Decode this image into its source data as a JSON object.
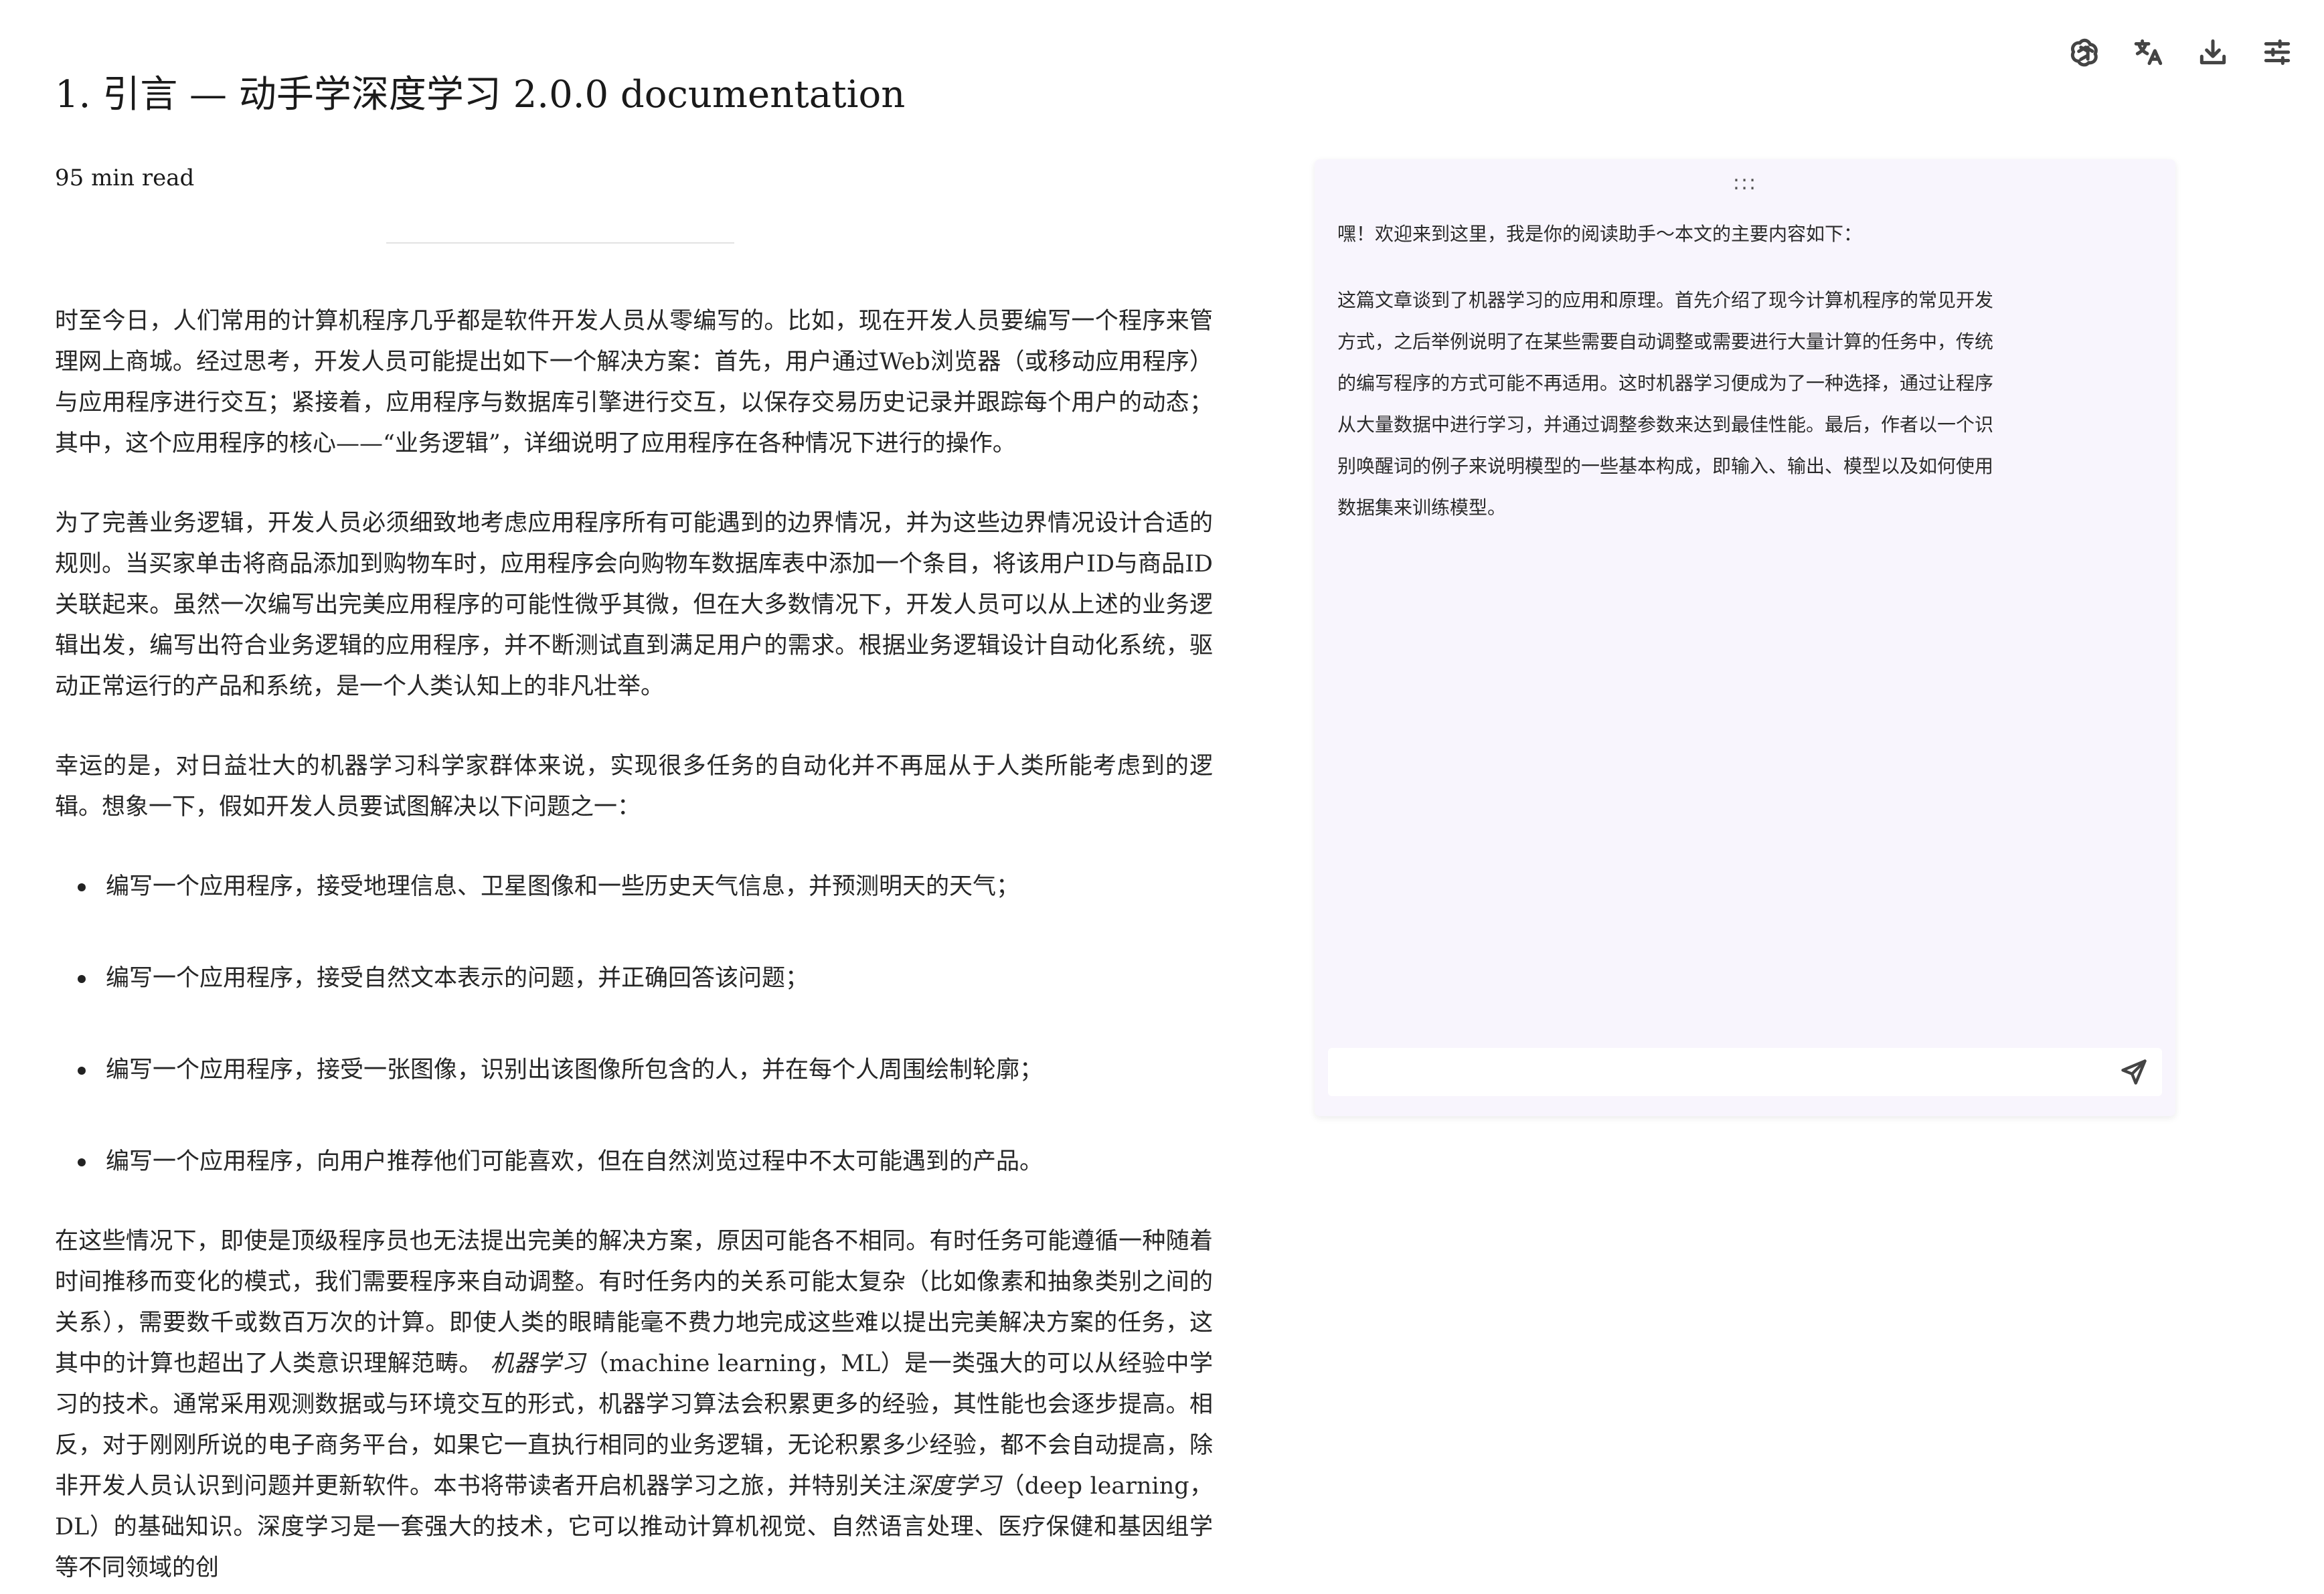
{
  "toolbar": {
    "icons": [
      "openai-icon",
      "translate-icon",
      "download-icon",
      "settings-sliders-icon"
    ]
  },
  "article": {
    "title": "1. 引言 — 动手学深度学习 2.0.0 documentation",
    "read_time": "95 min read",
    "paragraphs": [
      "时至今日，人们常用的计算机程序几乎都是软件开发人员从零编写的。比如，现在开发人员要编写一个程序来管理网上商城。经过思考，开发人员可能提出如下一个解决方案：首先，用户通过Web浏览器（或移动应用程序）与应用程序进行交互；紧接着，应用程序与数据库引擎进行交互，以保存交易历史记录并跟踪每个用户的动态；其中，这个应用程序的核心——“业务逻辑”，详细说明了应用程序在各种情况下进行的操作。",
      "为了完善业务逻辑，开发人员必须细致地考虑应用程序所有可能遇到的边界情况，并为这些边界情况设计合适的规则。当买家单击将商品添加到购物车时，应用程序会向购物车数据库表中添加一个条目，将该用户ID与商品ID关联起来。虽然一次编写出完美应用程序的可能性微乎其微，但在大多数情况下，开发人员可以从上述的业务逻辑出发，编写出符合业务逻辑的应用程序，并不断测试直到满足用户的需求。根据业务逻辑设计自动化系统，驱动正常运行的产品和系统，是一个人类认知上的非凡壮举。",
      "幸运的是，对日益壮大的机器学习科学家群体来说，实现很多任务的自动化并不再屈从于人类所能考虑到的逻辑。想象一下，假如开发人员要试图解决以下问题之一："
    ],
    "bullets": [
      "编写一个应用程序，接受地理信息、卫星图像和一些历史天气信息，并预测明天的天气；",
      "编写一个应用程序，接受自然文本表示的问题，并正确回答该问题；",
      "编写一个应用程序，接受一张图像，识别出该图像所包含的人，并在每个人周围绘制轮廓；",
      "编写一个应用程序，向用户推荐他们可能喜欢，但在自然浏览过程中不太可能遇到的产品。"
    ],
    "final_paragraph": {
      "part1": "在这些情况下，即使是顶级程序员也无法提出完美的解决方案，原因可能各不相同。有时任务可能遵循一种随着时间推移而变化的模式，我们需要程序来自动调整。有时任务内的关系可能太复杂（比如像素和抽象类别之间的关系），需要数千或数百万次的计算。即使人类的眼睛能毫不费力地完成这些难以提出完美解决方案的任务，这其中的计算也超出了人类意识理解范畴。",
      "term1": "机器学习",
      "part2": "（machine learning，ML）是一类强大的可以从经验中学习的技术。通常采用观测数据或与环境交互的形式，机器学习算法会积累更多的经验，其性能也会逐步提高。相反，对于刚刚所说的电子商务平台，如果它一直执行相同的业务逻辑，无论积累多少经验，都不会自动提高，除非开发人员认识到问题并更新软件。本书将带读者开启机器学习之旅，并特别关注",
      "term2": "深度学习",
      "part3": "（deep learning，DL）的基础知识。深度学习是一套强大的技术，它可以推动计算机视觉、自然语言处理、医疗保健和基因组学等不同领域的创"
    }
  },
  "assistant": {
    "handle": ":::",
    "greeting": "嘿！欢迎来到这里，我是你的阅读助手～本文的主要内容如下：",
    "summary": "这篇文章谈到了机器学习的应用和原理。首先介绍了现今计算机程序的常见开发方式，之后举例说明了在某些需要自动调整或需要进行大量计算的任务中，传统的编写程序的方式可能不再适用。这时机器学习便成为了一种选择，通过让程序从大量数据中进行学习，并通过调整参数来达到最佳性能。最后，作者以一个识别唤醒词的例子来说明模型的一些基本构成，即输入、输出、模型以及如何使用数据集来训练模型。",
    "input_value": "",
    "input_placeholder": ""
  },
  "colors": {
    "assistant_panel_bg": "#f8f5fd",
    "text": "#262626"
  }
}
